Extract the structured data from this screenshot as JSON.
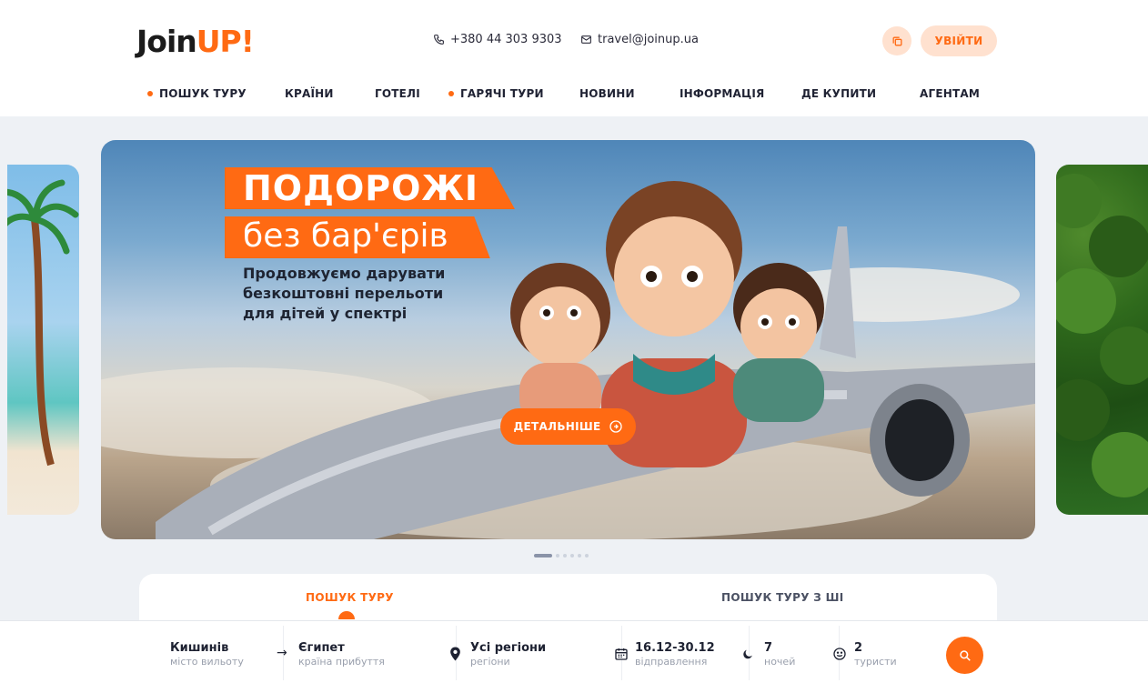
{
  "brand": {
    "logo_main": "Join",
    "logo_accent": "UP!",
    "accent_color": "#ff6a13"
  },
  "header": {
    "phone": "+380 44 303 9303",
    "email": "travel@joinup.ua",
    "login_label": "УВІЙТИ",
    "favorites_icon": "copy-icon"
  },
  "nav": {
    "items": [
      {
        "label": "ПОШУК ТУРУ",
        "dot": true
      },
      {
        "label": "КРАЇНИ",
        "dot": false
      },
      {
        "label": "ГОТЕЛІ",
        "dot": false
      },
      {
        "label": "ГАРЯЧІ ТУРИ",
        "dot": true
      },
      {
        "label": "НОВИНИ",
        "dot": false
      },
      {
        "label": "ІНФОРМАЦІЯ",
        "dot": false
      },
      {
        "label": "ДЕ КУПИТИ",
        "dot": false
      },
      {
        "label": "АГЕНТАМ",
        "dot": false
      }
    ]
  },
  "banner": {
    "title_line1": "ПОДОРОЖІ",
    "title_line2": "без бар'єрів",
    "subtitle": "Продовжуємо дарувати безкоштовні перельоти для дітей у спектрі",
    "button_label": "ДЕТАЛЬНІШЕ",
    "slide_count": 6,
    "active_slide": 1
  },
  "search": {
    "tabs": [
      {
        "label": "ПОШУК ТУРУ",
        "active": true
      },
      {
        "label": "ПОШУК ТУРУ З ШІ",
        "active": false
      }
    ],
    "fields": {
      "from": {
        "value": "Кишинів",
        "label": "місто вильоту"
      },
      "to": {
        "value": "Єгипет",
        "label": "країна прибуття"
      },
      "region": {
        "value": "Усі регіони",
        "label": "регіони"
      },
      "dates": {
        "value": "16.12-30.12",
        "label": "відправлення"
      },
      "nights": {
        "value": "7",
        "label": "ночей"
      },
      "tourists": {
        "value": "2",
        "label": "туристи"
      }
    }
  }
}
